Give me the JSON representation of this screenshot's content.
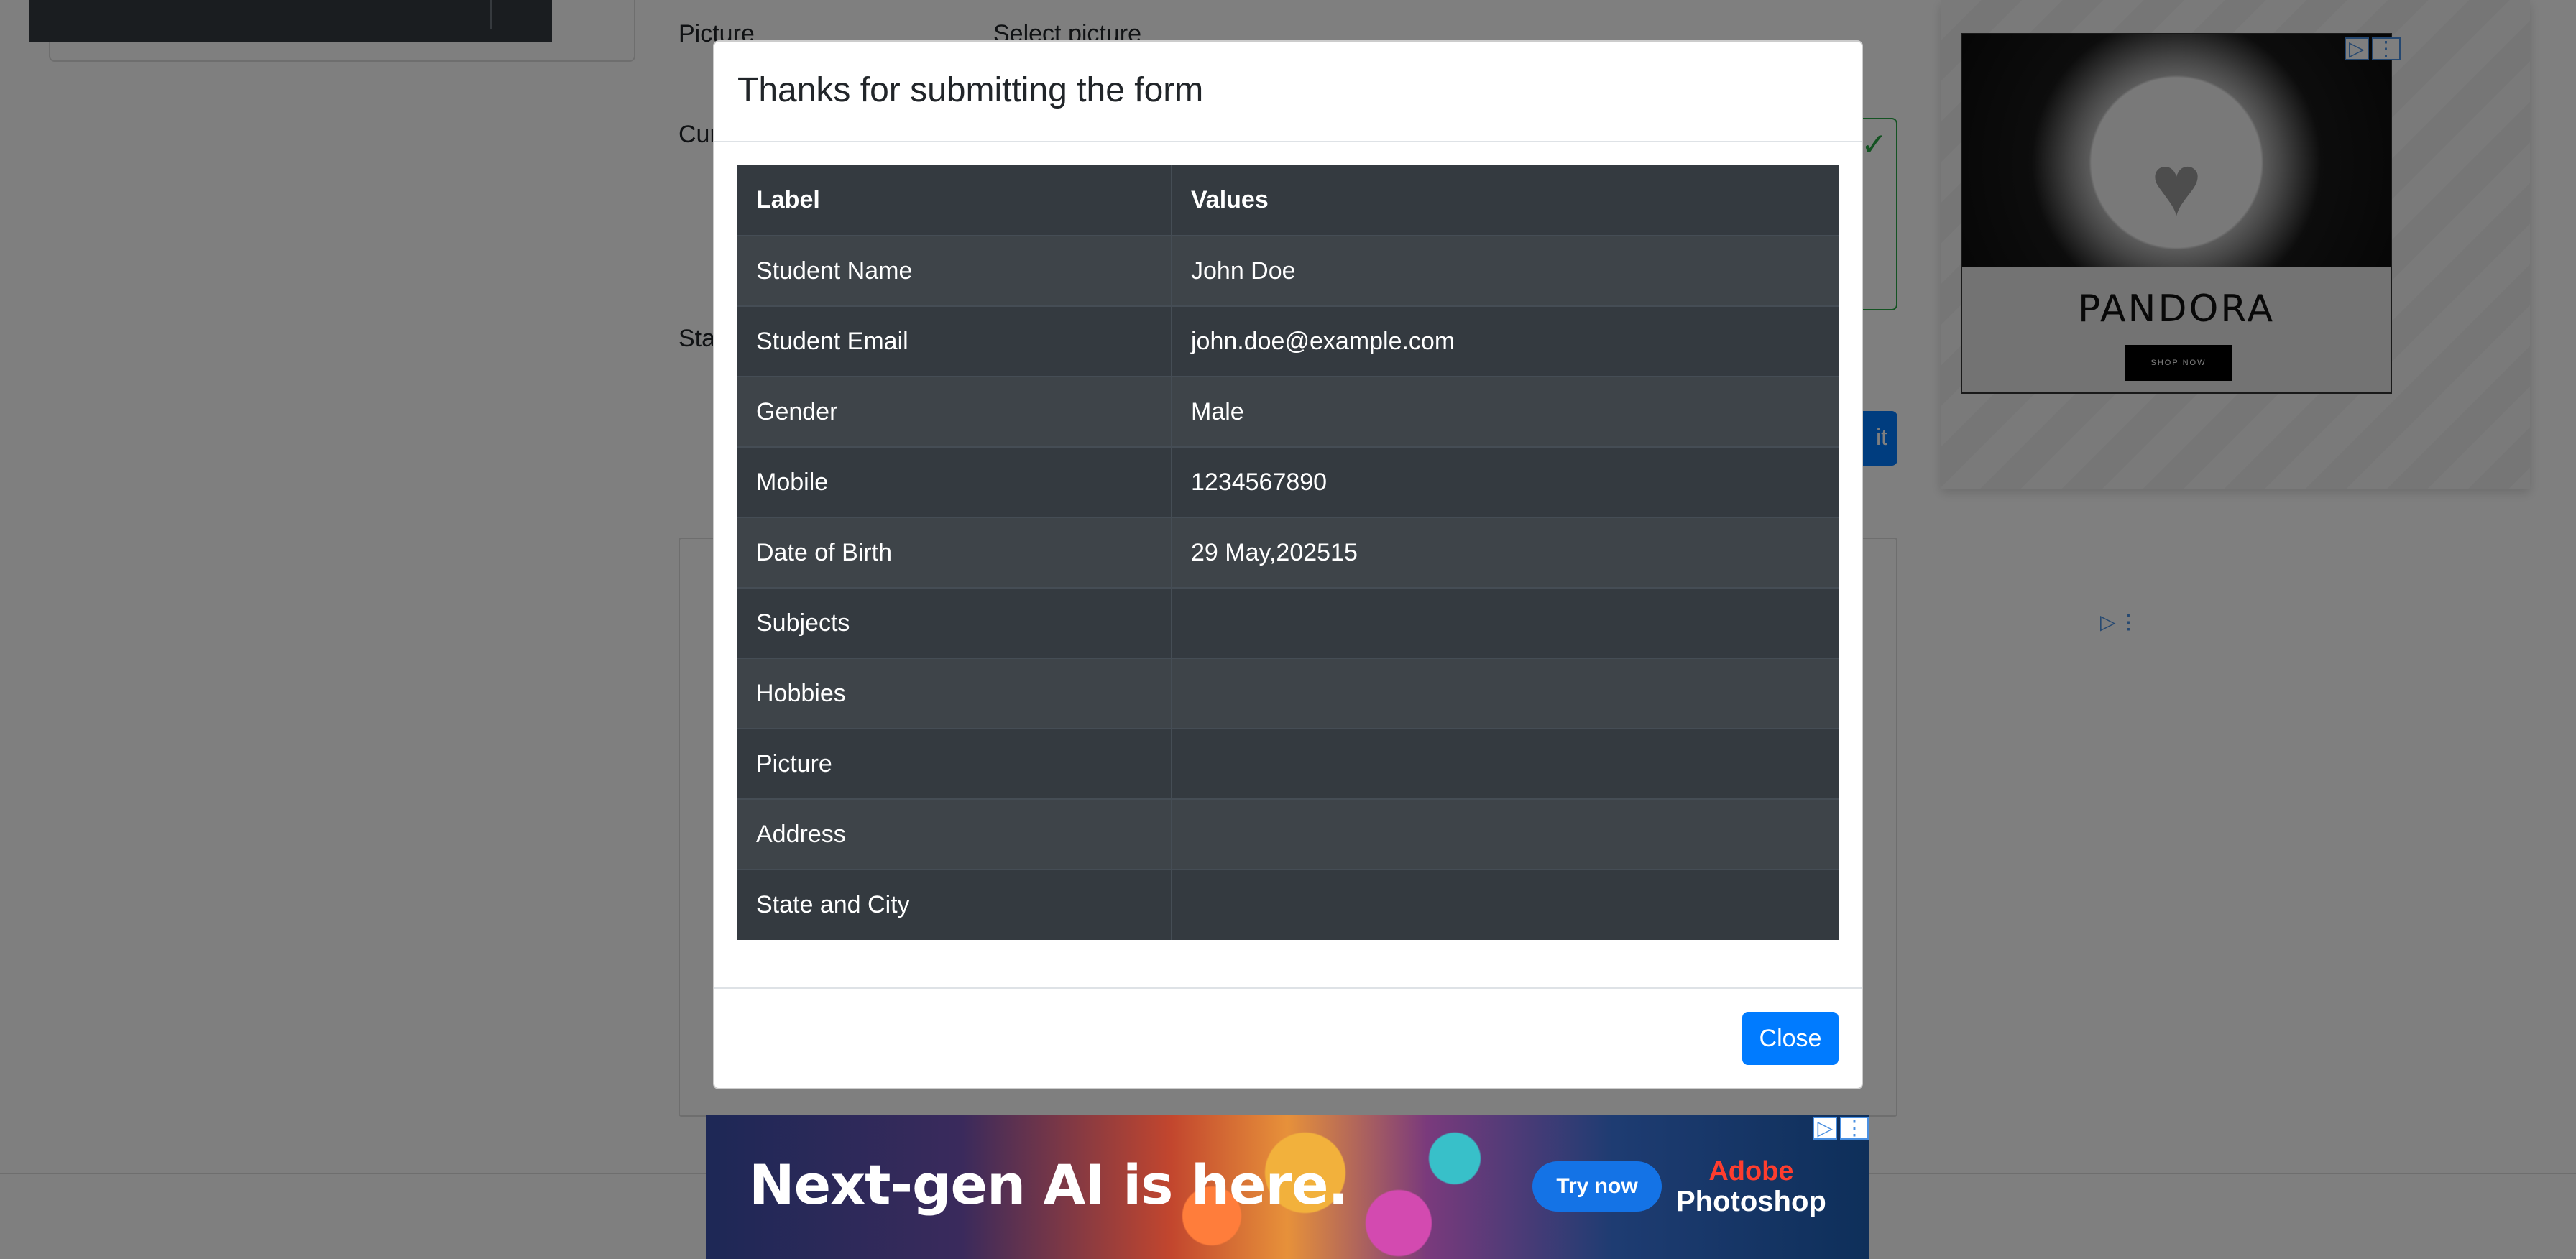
{
  "background": {
    "picture_label": "Picture",
    "select_picture": "Select picture",
    "current_address_label_partial": "Cur",
    "state_label_partial": "Sta",
    "submit_partial": "it"
  },
  "ads": {
    "pandora": {
      "brand": "PANDORA",
      "cta": "SHOP NOW",
      "adchoices_icon": "play-triangle-icon",
      "menu_icon": "kebab-menu-icon"
    },
    "photoshop": {
      "headline": "Next-gen AI is here.",
      "cta": "Try now",
      "brand_line1": "Adobe",
      "brand_line2": "Photoshop"
    }
  },
  "modal": {
    "title": "Thanks for submitting the form",
    "table": {
      "headers": [
        "Label",
        "Values"
      ],
      "rows": [
        {
          "label": "Student Name",
          "value": "John Doe"
        },
        {
          "label": "Student Email",
          "value": "john.doe@example.com"
        },
        {
          "label": "Gender",
          "value": "Male"
        },
        {
          "label": "Mobile",
          "value": "1234567890"
        },
        {
          "label": "Date of Birth",
          "value": "29 May,202515"
        },
        {
          "label": "Subjects",
          "value": ""
        },
        {
          "label": "Hobbies",
          "value": ""
        },
        {
          "label": "Picture",
          "value": ""
        },
        {
          "label": "Address",
          "value": ""
        },
        {
          "label": "State and City",
          "value": ""
        }
      ]
    },
    "close_label": "Close"
  },
  "colors": {
    "primary": "#007bff",
    "table_dark": "#343a40",
    "valid_green": "#28a745"
  }
}
